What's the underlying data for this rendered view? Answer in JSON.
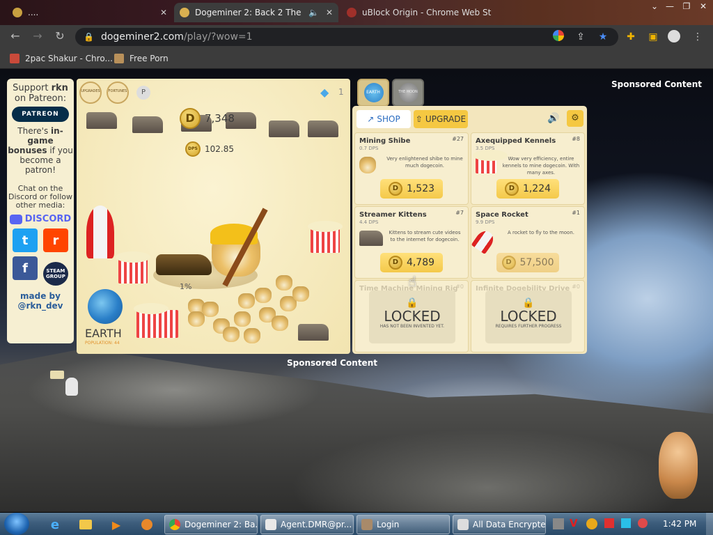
{
  "browser": {
    "tabs": [
      {
        "title": "...."
      },
      {
        "title": "Dogeminer 2: Back 2 The Mo"
      },
      {
        "title": "uBlock Origin - Chrome Web St"
      }
    ],
    "url_host": "dogeminer2.com",
    "url_path": "/play/?wow=1",
    "bookmarks": [
      {
        "label": "2pac Shakur - Chro..."
      },
      {
        "label": "Free Porn"
      }
    ]
  },
  "side_panel": {
    "support_line1": "Support",
    "support_name": "rkn",
    "support_line2": "on Patreon:",
    "patreon_button": "PATREON",
    "bonus_text_a": "There's",
    "bonus_text_b": "in-game bonuses",
    "bonus_text_c": "if you become a patron!",
    "chat_text": "Chat on the Discord or follow other media:",
    "discord_label": "DISCORD",
    "twitter_label": "t",
    "reddit_label": "r",
    "facebook_label": "f",
    "steam_label": "STEAM GROUP",
    "made_by": "made by",
    "author": "@rkn_dev"
  },
  "game": {
    "top_buttons": [
      {
        "label": "UPGRADES"
      },
      {
        "label": "FORTUNES"
      }
    ],
    "gems": "1",
    "coin_symbol": "D",
    "coins": "7,348",
    "dps_label": "DPS",
    "dps": "102.85",
    "progress": "1%",
    "planet_name": "EARTH",
    "population": "POPULATION: 44"
  },
  "world_tabs": [
    {
      "label": "EARTH"
    },
    {
      "label": "THE MOON"
    }
  ],
  "shop": {
    "tab_shop": "SHOP",
    "tab_upgrade": "UPGRADE",
    "items": [
      {
        "name": "Mining Shibe",
        "num": "#27",
        "dps": "0.7 DPS",
        "desc": "Very enlightened shibe to mine much dogecoin.",
        "price": "1,523"
      },
      {
        "name": "Axequipped Kennels",
        "num": "#8",
        "dps": "3.5 DPS",
        "desc": "Wow very efficiency, entire kennels to mine dogecoin. With many axes.",
        "price": "1,224"
      },
      {
        "name": "Streamer Kittens",
        "num": "#7",
        "dps": "4.4 DPS",
        "desc": "Kittens to stream cute videos to the internet for dogecoin.",
        "price": "4,789"
      },
      {
        "name": "Space Rocket",
        "num": "#1",
        "dps": "9.9 DPS",
        "desc": "A rocket to fly to the moon.",
        "price": "57,500"
      }
    ],
    "locked": [
      {
        "ghost": "Time Machine Mining Rig",
        "num": "#0",
        "title": "LOCKED",
        "sub": "HAS NOT BEEN INVENTED YET."
      },
      {
        "ghost": "Infinite Dogebility Drive",
        "num": "#0",
        "title": "LOCKED",
        "sub": "REQUIRES FURTHER PROGRESS"
      }
    ]
  },
  "sponsored": "Sponsored Content",
  "taskbar": {
    "items": [
      {
        "label": "Dogeminer 2: Ba..."
      },
      {
        "label": "Agent.DMR@pr..."
      },
      {
        "label": "Login"
      },
      {
        "label": "All Data Encrypted"
      }
    ],
    "clock": "1:42 PM"
  }
}
